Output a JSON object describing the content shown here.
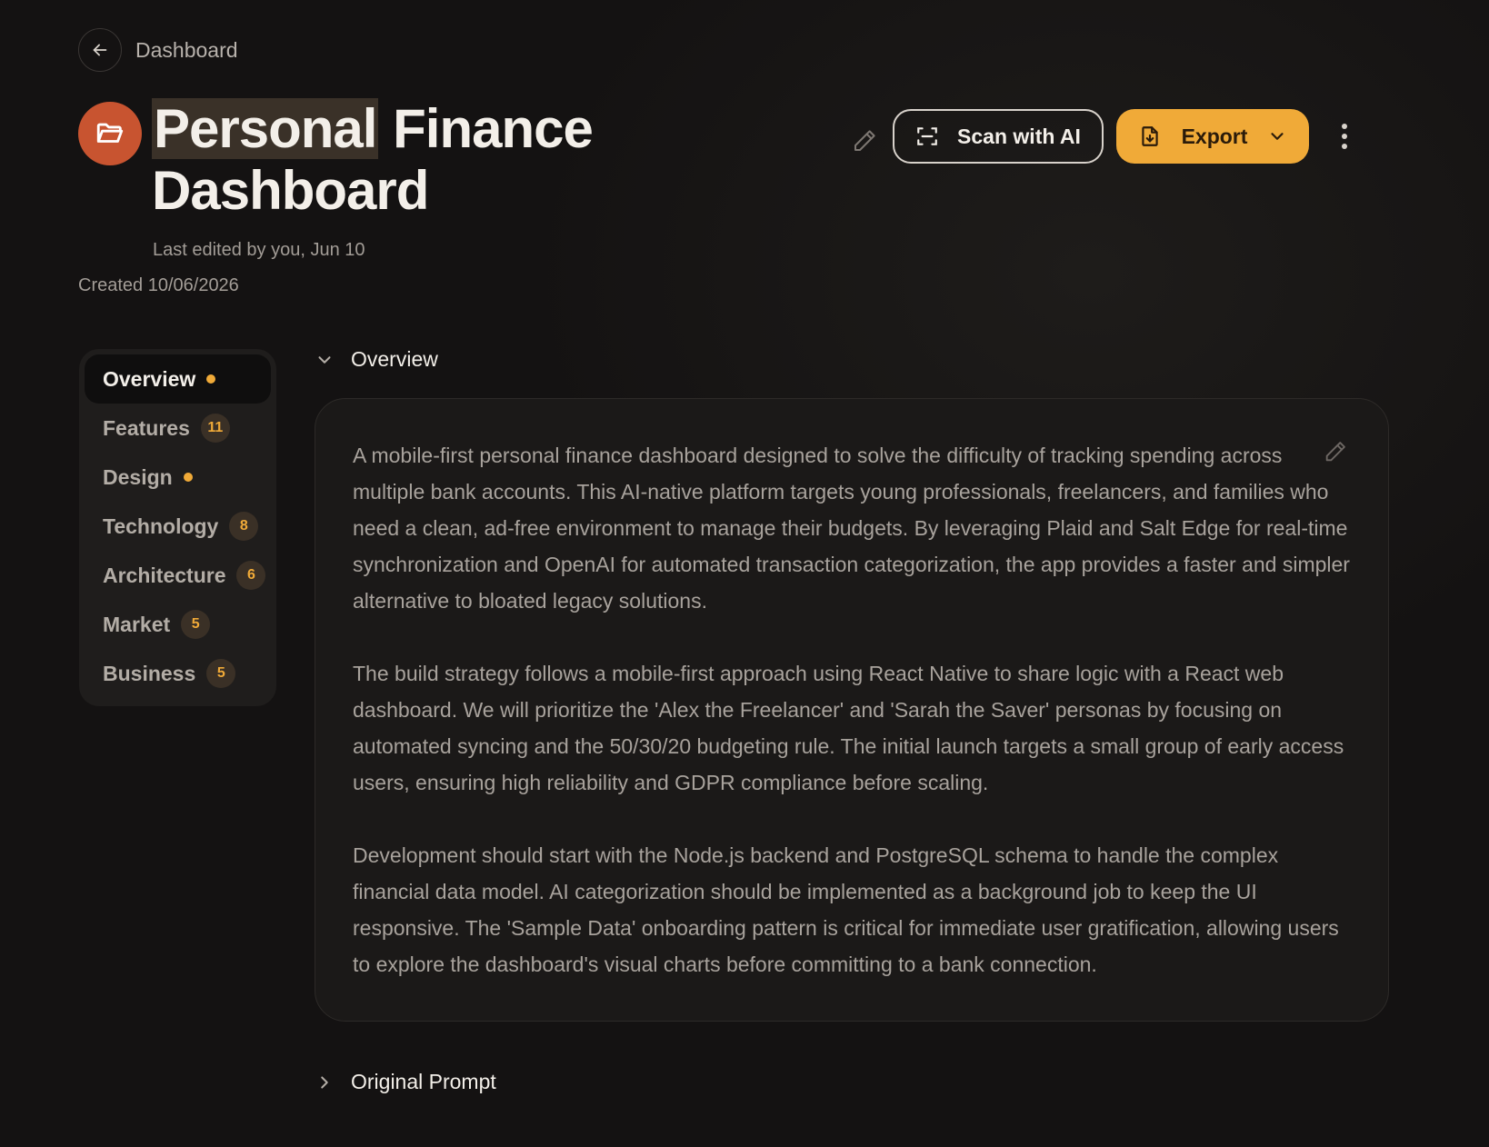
{
  "header": {
    "back_label": "Dashboard",
    "title_highlight": "Personal",
    "title_rest": " Finance Dashboard",
    "last_edited": "Last edited by you, Jun 10",
    "created": "Created 10/06/2026"
  },
  "actions": {
    "scan_label": "Scan with AI",
    "export_label": "Export"
  },
  "nav": {
    "items": [
      {
        "label": "Overview",
        "badge": "",
        "dot": true,
        "active": true
      },
      {
        "label": "Features",
        "badge": "11",
        "dot": false,
        "active": false
      },
      {
        "label": "Design",
        "badge": "",
        "dot": true,
        "active": false
      },
      {
        "label": "Technology",
        "badge": "8",
        "dot": false,
        "active": false
      },
      {
        "label": "Architecture",
        "badge": "6",
        "dot": false,
        "active": false
      },
      {
        "label": "Market",
        "badge": "5",
        "dot": false,
        "active": false
      },
      {
        "label": "Business",
        "badge": "5",
        "dot": false,
        "active": false
      }
    ]
  },
  "overview": {
    "heading": "Overview",
    "paragraphs": [
      "A mobile-first personal finance dashboard designed to solve the difficulty of tracking spending across multiple bank accounts. This AI-native platform targets young professionals, freelancers, and families who need a clean, ad-free environment to manage their budgets. By leveraging Plaid and Salt Edge for real-time synchronization and OpenAI for automated transaction categorization, the app provides a faster and simpler alternative to bloated legacy solutions.",
      "The build strategy follows a mobile-first approach using React Native to share logic with a React web dashboard. We will prioritize the 'Alex the Freelancer' and 'Sarah the Saver' personas by focusing on automated syncing and the 50/30/20 budgeting rule. The initial launch targets a small group of early access users, ensuring high reliability and GDPR compliance before scaling.",
      "Development should start with the Node.js backend and PostgreSQL schema to handle the complex financial data model. AI categorization should be implemented as a background job to keep the UI responsive. The 'Sample Data' onboarding pattern is critical for immediate user gratification, allowing users to explore the dashboard's visual charts before committing to a bank connection."
    ]
  },
  "original_prompt": {
    "heading": "Original Prompt"
  },
  "colors": {
    "accent": "#f0aa38",
    "project_icon": "#c85430",
    "background": "#141212"
  },
  "icons": {
    "back": "arrow-left-icon",
    "project": "folder-open-icon",
    "edit": "pencil-icon",
    "scan": "scan-frame-icon",
    "export": "file-download-icon",
    "more": "vertical-dots-icon"
  }
}
